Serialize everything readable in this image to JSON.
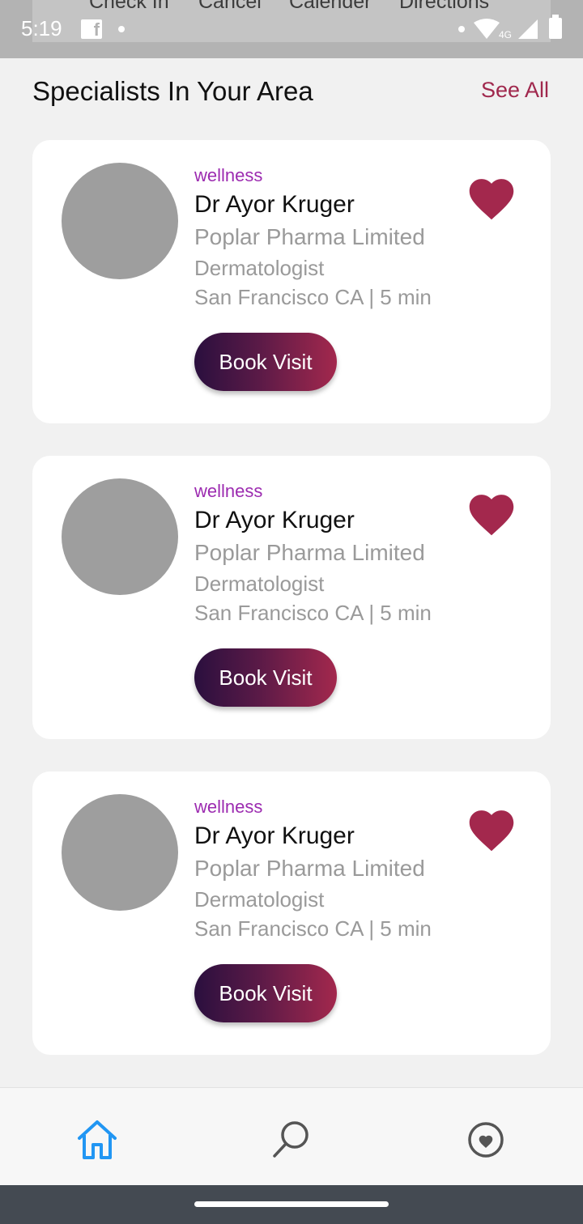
{
  "status_bar": {
    "time": "5:19",
    "network": "4G",
    "background_tabs": [
      "Check In",
      "Cancel",
      "Calender",
      "Directions"
    ]
  },
  "header": {
    "title": "Specialists In Your Area",
    "see_all_label": "See All"
  },
  "cards": [
    {
      "category": "wellness",
      "name": "Dr Ayor Kruger",
      "company": "Poplar Pharma Limited",
      "specialty": "Dermatologist",
      "location": "San Francisco CA | 5 min",
      "book_label": "Book Visit",
      "favorited": true
    },
    {
      "category": "wellness",
      "name": "Dr Ayor Kruger",
      "company": "Poplar Pharma Limited",
      "specialty": "Dermatologist",
      "location": "San Francisco CA | 5 min",
      "book_label": "Book Visit",
      "favorited": true
    },
    {
      "category": "wellness",
      "name": "Dr Ayor Kruger",
      "company": "Poplar Pharma Limited",
      "specialty": "Dermatologist",
      "location": "San Francisco CA | 5 min",
      "book_label": "Book Visit",
      "favorited": true
    }
  ],
  "bottom_nav": {
    "items": [
      {
        "icon": "home-icon",
        "active": true
      },
      {
        "icon": "search-icon",
        "active": false
      },
      {
        "icon": "heart-circle-icon",
        "active": false
      }
    ]
  },
  "colors": {
    "accent": "#a0284d",
    "category_text": "#9c2bb0",
    "heart": "#a3284d",
    "active_nav": "#2196f3",
    "inactive_nav": "#555555",
    "button_gradient": [
      "#2a0f3e",
      "#a3284d"
    ]
  }
}
